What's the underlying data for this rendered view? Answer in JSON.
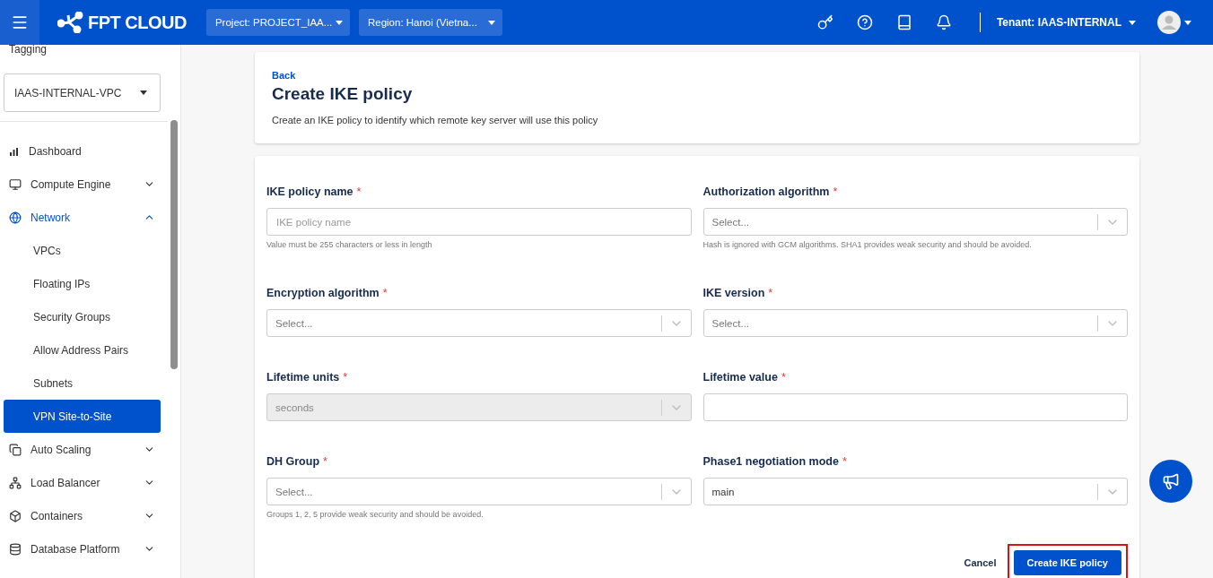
{
  "topbar": {
    "brand": "FPT CLOUD",
    "project": "Project: PROJECT_IAA...",
    "region": "Region: Hanoi (Vietna...",
    "tenant": "Tenant: IAAS-INTERNAL"
  },
  "sidebar": {
    "top_item": "Tagging",
    "vpc_select": "IAAS-INTERNAL-VPC",
    "items": [
      {
        "kind": "link",
        "label": "Dashboard",
        "selected": false
      },
      {
        "kind": "group",
        "label": "Compute Engine",
        "expanded": false,
        "selected": false
      },
      {
        "kind": "group",
        "label": "Network",
        "expanded": true,
        "selected": true,
        "children": [
          {
            "label": "VPCs",
            "selected": false
          },
          {
            "label": "Floating IPs",
            "selected": false
          },
          {
            "label": "Security Groups",
            "selected": false
          },
          {
            "label": "Allow Address Pairs",
            "selected": false
          },
          {
            "label": "Subnets",
            "selected": false
          },
          {
            "label": "VPN Site-to-Site",
            "selected": true
          }
        ]
      },
      {
        "kind": "group",
        "label": "Auto Scaling",
        "expanded": false,
        "selected": false
      },
      {
        "kind": "group",
        "label": "Load Balancer",
        "expanded": false,
        "selected": false
      },
      {
        "kind": "group",
        "label": "Containers",
        "expanded": false,
        "selected": false
      },
      {
        "kind": "group",
        "label": "Database Platform",
        "expanded": false,
        "selected": false
      }
    ]
  },
  "header": {
    "back": "Back",
    "title": "Create IKE policy",
    "description": "Create an IKE policy to identify which remote key server will use this policy"
  },
  "form": {
    "fields": [
      {
        "kind": "text",
        "label": "IKE policy name",
        "required_mark": "*",
        "placeholder": "IKE policy name",
        "hint": "Value must be 255 characters or less in length",
        "disabled": false
      },
      {
        "kind": "select",
        "label": "Authorization algorithm",
        "required_mark": "*",
        "placeholder": "Select...",
        "hint": "Hash is ignored with GCM algorithms. SHA1 provides weak security and should be avoided.",
        "disabled": false
      },
      {
        "kind": "select",
        "label": "Encryption algorithm",
        "required_mark": "*",
        "placeholder": "Select...",
        "disabled": false
      },
      {
        "kind": "select",
        "label": "IKE version",
        "required_mark": "*",
        "placeholder": "Select...",
        "disabled": false
      },
      {
        "kind": "select",
        "label": "Lifetime units",
        "required_mark": "*",
        "value": "seconds",
        "disabled": true
      },
      {
        "kind": "text",
        "label": "Lifetime value",
        "required_mark": "*",
        "disabled": false
      },
      {
        "kind": "select",
        "label": "DH Group",
        "required_mark": "*",
        "placeholder": "Select...",
        "hint": "Groups 1, 2, 5 provide weak security and should be avoided.",
        "disabled": false
      },
      {
        "kind": "select",
        "label": "Phase1 negotiation mode",
        "required_mark": "*",
        "value": "main",
        "disabled": false
      }
    ],
    "cancel": "Cancel",
    "submit": {
      "label": "Create IKE policy",
      "highlighted": true
    }
  }
}
